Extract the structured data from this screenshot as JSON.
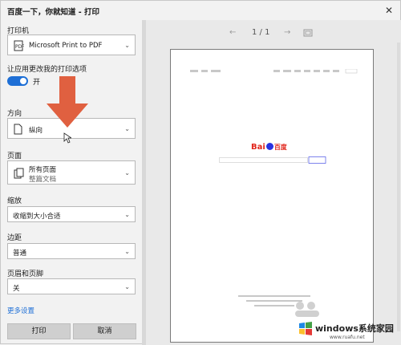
{
  "window": {
    "title": "百度一下，你就知道 - 打印",
    "close_symbol": "✕"
  },
  "printer": {
    "label": "打印机",
    "value": "Microsoft Print to PDF"
  },
  "app_options": {
    "label": "让应用更改我的打印选项",
    "toggle_on": true,
    "toggle_text": "开"
  },
  "orientation": {
    "label": "方向",
    "value": "纵向"
  },
  "pages": {
    "label": "页面",
    "value": "所有页面",
    "sub": "整篇文档"
  },
  "scale": {
    "label": "缩放",
    "value": "收缩到大小合适"
  },
  "margins": {
    "label": "边距",
    "value": "普通"
  },
  "header_footer": {
    "label": "页眉和页脚",
    "value": "关"
  },
  "more_settings": "更多设置",
  "buttons": {
    "print": "打印",
    "cancel": "取消"
  },
  "preview": {
    "prev": "←",
    "page_indicator": "1 / 1",
    "next": "→",
    "fit_icon": "fit-page-icon",
    "logo_text_a": "Bai",
    "logo_text_b": "百度"
  },
  "watermark": {
    "text": "windows系统家园",
    "url": "www.ruafu.net"
  },
  "colors": {
    "accent": "#1e6fd6",
    "arrow": "#e06040",
    "baidu_red": "#e1251b",
    "baidu_blue": "#2932e1"
  }
}
